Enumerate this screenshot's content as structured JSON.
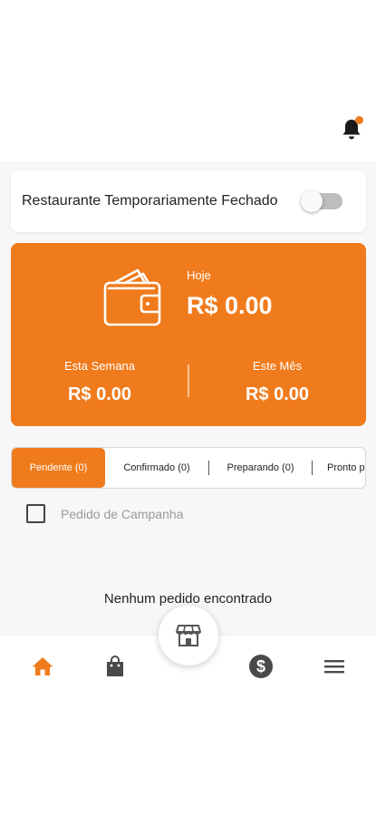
{
  "header": {
    "notification_icon": "bell-icon",
    "has_unread": true
  },
  "store_status": {
    "label": "Restaurante Temporariamente Fechado",
    "enabled": false
  },
  "earnings": {
    "today_label": "Hoje",
    "today_value": "R$ 0.00",
    "week_label": "Esta Semana",
    "week_value": "R$ 0.00",
    "month_label": "Este Mês",
    "month_value": "R$ 0.00",
    "accent": "#f07b1c"
  },
  "tabs": [
    {
      "label": "Pendente (0)",
      "active": true
    },
    {
      "label": "Confirmado (0)",
      "active": false
    },
    {
      "label": "Preparando (0)",
      "active": false
    },
    {
      "label": "Pronto p",
      "active": false
    }
  ],
  "campaign_filter": {
    "label": "Pedido de Campanha",
    "checked": false
  },
  "empty_message": "Nenhum pedido encontrado",
  "bottom_nav": {
    "items": [
      "home-icon",
      "bag-icon",
      "store-icon",
      "dollar-icon",
      "menu-icon"
    ],
    "active": "home-icon"
  }
}
